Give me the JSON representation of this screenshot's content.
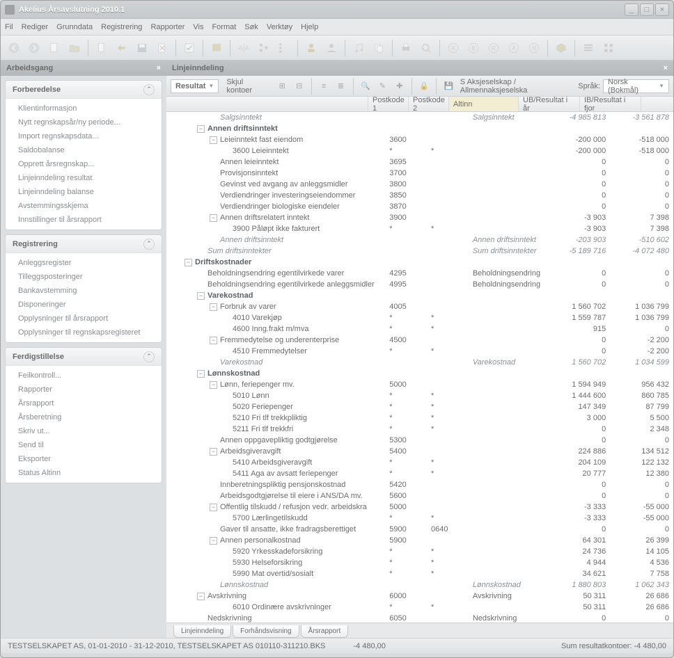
{
  "window": {
    "title": "Akelius Årsavslutning 2010.1"
  },
  "menubar": [
    "Fil",
    "Rediger",
    "Grunndata",
    "Registrering",
    "Rapporter",
    "Vis",
    "Format",
    "Søk",
    "Verktøy",
    "Hjelp"
  ],
  "left_panel": {
    "title": "Arbeidsgang"
  },
  "right_panel": {
    "title": "Linjeinndeling"
  },
  "accordions": [
    {
      "title": "Forberedelse",
      "items": [
        "Klientinformasjon",
        "Nytt regnskapsår/ny periode...",
        "Import regnskapsdata...",
        "Saldobalanse",
        "Opprett årsregnskap...",
        "Linjeinndeling resultat",
        "Linjeinndeling balanse",
        "Avstemmingsskjema",
        "Innstillinger til årsrapport"
      ]
    },
    {
      "title": "Registrering",
      "items": [
        "Anleggsregister",
        "Tilleggsposteringer",
        "Bankavstemming",
        "Disponeringer",
        "Opplysninger til årsrapport",
        "Opplysninger til regnskapsregisteret"
      ]
    },
    {
      "title": "Ferdigstillelse",
      "items": [
        "Feilkontroll...",
        "Rapporter",
        "Årsrapport",
        "Årsberetning",
        "Skriv ut...",
        "Send til",
        "Eksporter",
        "Status Altinn"
      ]
    }
  ],
  "subtoolbar": {
    "dropdown": "Resultat",
    "skjul": "Skjul kontoer",
    "company": "S Aksjeselskap / Allmennaksjeselska",
    "language_label": "Språk:",
    "language": "Norsk (Bokmål)"
  },
  "columns": {
    "p1": "Postkode 1",
    "p2": "Postkode 2",
    "altinn": "Altinn",
    "ub": "UB/Resultat i år",
    "ib": "IB/Resultat i fjor"
  },
  "rows": [
    {
      "i": 3,
      "e": "",
      "n": "Salgsinntekt",
      "it": true,
      "alt": "Salgsinntekt",
      "ub": "-4 985 813",
      "ib": "-3 561 878"
    },
    {
      "i": 2,
      "e": "-",
      "n": "Annen driftsinntekt",
      "b": true
    },
    {
      "i": 3,
      "e": "-",
      "n": "Leieinntekt fast eiendom",
      "p1": "3600",
      "ub": "-200 000",
      "ib": "-518 000"
    },
    {
      "i": 4,
      "e": "",
      "n": "3600 Leieinntekt",
      "p1": "*",
      "p2": "*",
      "ub": "-200 000",
      "ib": "-518 000"
    },
    {
      "i": 3,
      "e": "",
      "n": "Annen leieinntekt",
      "p1": "3695",
      "ub": "0",
      "ib": "0"
    },
    {
      "i": 3,
      "e": "",
      "n": "Provisjonsinntekt",
      "p1": "3700",
      "ub": "0",
      "ib": "0"
    },
    {
      "i": 3,
      "e": "",
      "n": "Gevinst ved avgang av anleggsmidler",
      "p1": "3800",
      "ub": "0",
      "ib": "0"
    },
    {
      "i": 3,
      "e": "",
      "n": "Verdiendringer investeringseiendommer",
      "p1": "3850",
      "ub": "0",
      "ib": "0"
    },
    {
      "i": 3,
      "e": "",
      "n": "Verdiendringer biologiske eiendeler",
      "p1": "3870",
      "ub": "0",
      "ib": "0"
    },
    {
      "i": 3,
      "e": "-",
      "n": "Annen driftsrelatert inntekt",
      "p1": "3900",
      "ub": "-3 903",
      "ib": "7 398"
    },
    {
      "i": 4,
      "e": "",
      "n": "3900 Påløpt ikke fakturert",
      "p1": "*",
      "p2": "*",
      "ub": "-3 903",
      "ib": "7 398"
    },
    {
      "i": 3,
      "e": "",
      "n": "Annen driftsinntekt",
      "it": true,
      "alt": "Annen driftsinntekt",
      "ub": "-203 903",
      "ib": "-510 602"
    },
    {
      "i": 2,
      "e": "",
      "n": "Sum driftsinntekter",
      "it": true,
      "alt": "Sum driftsinntekter",
      "ub": "-5 189 716",
      "ib": "-4 072 480"
    },
    {
      "i": 1,
      "e": "-",
      "n": "Driftskostnader",
      "b": true
    },
    {
      "i": 2,
      "e": "",
      "n": "Beholdningsendring egentilvirkede varer",
      "p1": "4295",
      "alt": "Beholdningsendring",
      "ub": "0",
      "ib": "0"
    },
    {
      "i": 2,
      "e": "",
      "n": "Beholdningsendring egentilvirkede anleggsmidler",
      "p1": "4995",
      "alt": "Beholdningsendring",
      "ub": "0",
      "ib": "0"
    },
    {
      "i": 2,
      "e": "-",
      "n": "Varekostnad",
      "b": true
    },
    {
      "i": 3,
      "e": "-",
      "n": "Forbruk av varer",
      "p1": "4005",
      "ub": "1 560 702",
      "ib": "1 036 799"
    },
    {
      "i": 4,
      "e": "",
      "n": "4010 Varekjøp",
      "p1": "*",
      "p2": "*",
      "ub": "1 559 787",
      "ib": "1 036 799"
    },
    {
      "i": 4,
      "e": "",
      "n": "4600 Inng.frakt m/mva",
      "p1": "*",
      "p2": "*",
      "ub": "915",
      "ib": "0"
    },
    {
      "i": 3,
      "e": "-",
      "n": "Fremmedytelse og underenterprise",
      "p1": "4500",
      "ub": "0",
      "ib": "-2 200"
    },
    {
      "i": 4,
      "e": "",
      "n": "4510 Fremmedytelser",
      "p1": "*",
      "p2": "*",
      "ub": "0",
      "ib": "-2 200"
    },
    {
      "i": 3,
      "e": "",
      "n": "Varekostnad",
      "it": true,
      "alt": "Varekostnad",
      "ub": "1 560 702",
      "ib": "1 034 599"
    },
    {
      "i": 2,
      "e": "-",
      "n": "Lønnskostnad",
      "b": true
    },
    {
      "i": 3,
      "e": "-",
      "n": "Lønn, feriepenger mv.",
      "p1": "5000",
      "ub": "1 594 949",
      "ib": "956 432"
    },
    {
      "i": 4,
      "e": "",
      "n": "5010 Lønn",
      "p1": "*",
      "p2": "*",
      "ub": "1 444 600",
      "ib": "860 785"
    },
    {
      "i": 4,
      "e": "",
      "n": "5020 Feriepenger",
      "p1": "*",
      "p2": "*",
      "ub": "147 349",
      "ib": "87 799"
    },
    {
      "i": 4,
      "e": "",
      "n": "5210 Fri tlf trekkpliktig",
      "p1": "*",
      "p2": "*",
      "ub": "3 000",
      "ib": "5 500"
    },
    {
      "i": 4,
      "e": "",
      "n": "5211 Fri tlf trekkfri",
      "p1": "*",
      "p2": "*",
      "ub": "0",
      "ib": "2 348"
    },
    {
      "i": 3,
      "e": "",
      "n": "Annen oppgavepliktig godtgjørelse",
      "p1": "5300",
      "ub": "0",
      "ib": "0"
    },
    {
      "i": 3,
      "e": "-",
      "n": "Arbeidsgiveravgift",
      "p1": "5400",
      "ub": "224 886",
      "ib": "134 512"
    },
    {
      "i": 4,
      "e": "",
      "n": "5410 Arbeidsgiveravgift",
      "p1": "*",
      "p2": "*",
      "ub": "204 109",
      "ib": "122 132"
    },
    {
      "i": 4,
      "e": "",
      "n": "5411 Aga av avsatt feriepenger",
      "p1": "*",
      "p2": "*",
      "ub": "20 777",
      "ib": "12 380"
    },
    {
      "i": 3,
      "e": "",
      "n": "Innberetningspliktig pensjonskostnad",
      "p1": "5420",
      "ub": "0",
      "ib": "0"
    },
    {
      "i": 3,
      "e": "",
      "n": "Arbeidsgodtgjørelse til eiere i ANS/DA mv.",
      "p1": "5600",
      "ub": "0",
      "ib": "0"
    },
    {
      "i": 3,
      "e": "-",
      "n": "Offentlig tilskudd / refusjon vedr. arbeidskra",
      "p1": "5000",
      "ub": "-3 333",
      "ib": "-55 000"
    },
    {
      "i": 4,
      "e": "",
      "n": "5700 Lærlingetilskudd",
      "p1": "*",
      "p2": "*",
      "ub": "-3 333",
      "ib": "-55 000"
    },
    {
      "i": 3,
      "e": "",
      "n": "Gaver til ansatte, ikke fradragsberettiget",
      "p1": "5900",
      "p2": "0640",
      "ub": "0",
      "ib": "0"
    },
    {
      "i": 3,
      "e": "-",
      "n": "Annen personalkostnad",
      "p1": "5900",
      "ub": "64 301",
      "ib": "26 399"
    },
    {
      "i": 4,
      "e": "",
      "n": "5920 Yrkesskadeforsikring",
      "p1": "*",
      "p2": "*",
      "ub": "24 736",
      "ib": "14 105"
    },
    {
      "i": 4,
      "e": "",
      "n": "5930 Helseforsikring",
      "p1": "*",
      "p2": "*",
      "ub": "4 944",
      "ib": "4 536"
    },
    {
      "i": 4,
      "e": "",
      "n": "5990 Mat overtid/sosialt",
      "p1": "*",
      "p2": "*",
      "ub": "34 621",
      "ib": "7 758"
    },
    {
      "i": 3,
      "e": "",
      "n": "Lønnskostnad",
      "it": true,
      "alt": "Lønnskostnad",
      "ub": "1 880 803",
      "ib": "1 062 343"
    },
    {
      "i": 2,
      "e": "-",
      "n": "Avskrivning",
      "p1": "6000",
      "alt": "Avskrivning",
      "ub": "50 311",
      "ib": "26 686"
    },
    {
      "i": 4,
      "e": "",
      "n": "6010 Ordinære avskrivninger",
      "p1": "*",
      "p2": "*",
      "ub": "50 311",
      "ib": "26 686"
    },
    {
      "i": 2,
      "e": "",
      "n": "Nedskrivning",
      "p1": "6050",
      "alt": "Nedskrivning",
      "ub": "0",
      "ib": "0"
    }
  ],
  "bottom_tabs": [
    "Linjeinndeling",
    "Forhåndsvisning",
    "Årsrapport"
  ],
  "statusbar": {
    "left": "TESTSELSKAPET AS, 01-01-2010 - 31-12-2010, TESTSELSKAPET AS 010110-311210.BKS",
    "mid": "-4 480,00",
    "right": "Sum resultatkontoer: -4 480,00"
  }
}
